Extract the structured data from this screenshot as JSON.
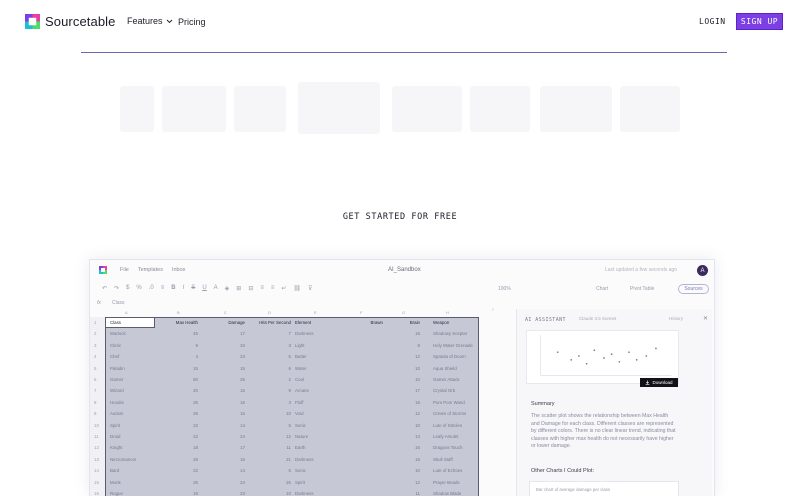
{
  "nav": {
    "brand": "Sourcetable",
    "features": "Features",
    "pricing": "Pricing",
    "login": "LOGIN",
    "signup": "SIGN UP"
  },
  "hero": {
    "cta": "GET STARTED FOR FREE"
  },
  "app": {
    "menu": [
      "File",
      "Templates",
      "Inbox"
    ],
    "title": "AI_Sandbox",
    "ghost_text": "Last updated a few seconds ago",
    "avatar": "A",
    "zoom": "100%",
    "chart": "Chart",
    "pivot": "Pivot Table",
    "source": "Sources",
    "formula_prefix": "fx",
    "formula_value": "Class",
    "columns": [
      "A",
      "B",
      "C",
      "D",
      "E",
      "F",
      "G",
      "H"
    ],
    "sheet_headers": [
      "Class",
      "Max Health",
      "Damage",
      "Hits Per Second",
      "Element",
      "Brawn",
      "Brain",
      "Weapon"
    ],
    "rows": [
      [
        "Warlock",
        "45",
        "17",
        "7",
        "Darkness",
        "",
        "16",
        "Shadowy Scepter"
      ],
      [
        "Cleric",
        "9",
        "34",
        "3",
        "Light",
        "",
        "8",
        "Holy Water Grenade"
      ],
      [
        "Chef",
        "4",
        "23",
        "5",
        "Butter",
        "",
        "12",
        "Spatula of Doom"
      ],
      [
        "Paladin",
        "15",
        "15",
        "6",
        "Water",
        "",
        "10",
        "Aqua Shield"
      ],
      [
        "Gamer",
        "50",
        "25",
        "2",
        "Cool",
        "",
        "10",
        "Gamer Attack"
      ],
      [
        "Wizard",
        "20",
        "15",
        "9",
        "Arcane",
        "",
        "17",
        "Crystal Orb"
      ],
      [
        "Hoodie",
        "25",
        "16",
        "3",
        "Fluff",
        "",
        "16",
        "Pom Pom Wand"
      ],
      [
        "Autism",
        "26",
        "16",
        "10",
        "Void",
        "",
        "12",
        "Cream of Storms"
      ],
      [
        "Spirit",
        "22",
        "14",
        "5",
        "Sonic",
        "",
        "10",
        "Lute of Stricles"
      ],
      [
        "Druid",
        "22",
        "24",
        "12",
        "Nature",
        "",
        "14",
        "Leafy Amulet"
      ],
      [
        "Knight",
        "18",
        "17",
        "11",
        "Earth",
        "",
        "16",
        "Dragons Touch"
      ],
      [
        "Necromancer",
        "28",
        "15",
        "21",
        "Darkness",
        "",
        "16",
        "Skull Staff"
      ],
      [
        "Bard",
        "22",
        "14",
        "5",
        "Sonic",
        "",
        "10",
        "Lute of Echoes"
      ],
      [
        "Monk",
        "25",
        "24",
        "26",
        "Spirit",
        "",
        "12",
        "Prayer Beads"
      ],
      [
        "Rogue",
        "19",
        "23",
        "10",
        "Darkness",
        "",
        "11",
        "Shadow Blade"
      ]
    ],
    "ai": {
      "title": "AI ASSISTANT",
      "model": "Claude 3.5 Sonnet",
      "history": "History",
      "download": "Download",
      "summary_heading": "Summary",
      "summary_text": "The scatter plot shows the relationship between Max Health and Damage for each class. Different classes are represented by different colors. There is no clear linear trend, indicating that classes with higher max health do not necessarily have higher or lower damage.",
      "other_heading": "Other Charts I Could Plot:",
      "prompt_preview": "Bar chart of average damage per class"
    }
  }
}
